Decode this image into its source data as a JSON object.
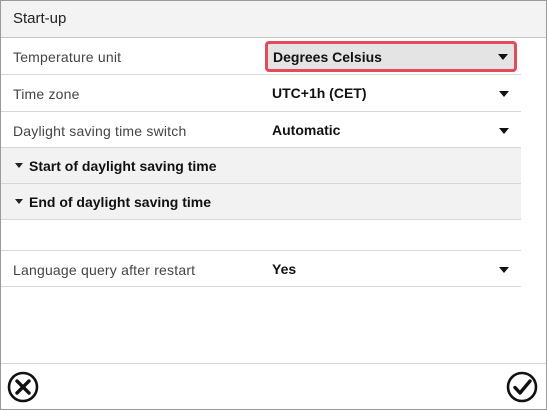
{
  "header": {
    "title": "Start-up"
  },
  "rows": [
    {
      "label": "Temperature unit",
      "value": "Degrees Celsius"
    },
    {
      "label": "Time zone",
      "value": "UTC+1h (CET)"
    },
    {
      "label": "Daylight saving time switch",
      "value": "Automatic"
    }
  ],
  "sections": [
    {
      "label": "Start of daylight saving time"
    },
    {
      "label": "End of daylight saving time"
    }
  ],
  "language_row": {
    "label": "Language query after restart",
    "value": "Yes"
  },
  "footer": {
    "cancel_icon": "close-circle-icon",
    "confirm_icon": "check-circle-icon"
  },
  "colors": {
    "focus_border": "#e24b5a",
    "header_bg": "#f3f3f3",
    "section_bg": "#f2f2f2"
  }
}
